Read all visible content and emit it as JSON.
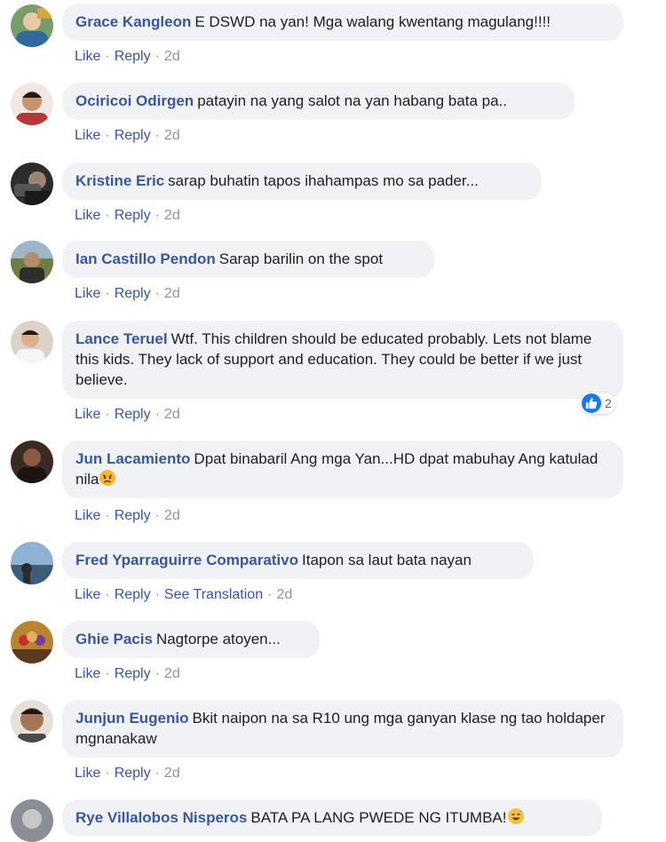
{
  "comments": [
    {
      "author": "Grace Kangleon",
      "text": "E DSWD na yan! Mga walang kwentang magulang!!!!",
      "actions": [
        "Like",
        "Reply"
      ],
      "time": "2d",
      "avatar_color": "#7a9c6a"
    },
    {
      "author": "Ociricoi Odirgen",
      "text": "patayin na yang salot na yan habang bata pa..",
      "actions": [
        "Like",
        "Reply"
      ],
      "time": "2d",
      "avatar_color": "#b36a5c"
    },
    {
      "author": "Kristine Eric",
      "text": "sarap buhatin tapos ihahampas mo sa pader...",
      "actions": [
        "Like",
        "Reply"
      ],
      "time": "2d",
      "avatar_color": "#3b3b3b"
    },
    {
      "author": "Ian Castillo Pendon",
      "text": "Sarap barilin on the spot",
      "actions": [
        "Like",
        "Reply"
      ],
      "time": "2d",
      "avatar_color": "#5d6b3a"
    },
    {
      "author": "Lance Teruel",
      "text": "Wtf. This children should be educated probably. Lets not blame this kids. They lack of support and education. They could be better if we just believe.",
      "actions": [
        "Like",
        "Reply"
      ],
      "time": "2d",
      "avatar_color": "#c9b8a8",
      "reaction_count": "2"
    },
    {
      "author": "Jun Lacamiento",
      "text": "Dpat binabaril Ang mga Yan...HD dpat mabuhay Ang katulad nila",
      "actions": [
        "Like",
        "Reply"
      ],
      "time": "2d",
      "avatar_color": "#5a3a2e",
      "emoji": "angry-face"
    },
    {
      "author": "Fred Yparraguirre Comparativo",
      "text": "Itapon sa laut bata nayan",
      "actions": [
        "Like",
        "Reply",
        "See Translation"
      ],
      "time": "2d",
      "avatar_color": "#4a7fae"
    },
    {
      "author": "Ghie Pacis",
      "text": "Nagtorpe atoyen...",
      "actions": [
        "Like",
        "Reply"
      ],
      "time": "2d",
      "avatar_color": "#c7902e"
    },
    {
      "author": "Junjun Eugenio",
      "text": "Bkit naipon na sa R10 ung mga ganyan klase ng tao holdaper mgnanakaw",
      "actions": [
        "Like",
        "Reply"
      ],
      "time": "2d",
      "avatar_color": "#7a5a48"
    },
    {
      "author": "Rye Villalobos Nisperos",
      "text": "BATA PA LANG PWEDE NG ITUMBA!",
      "actions": [],
      "time": "",
      "avatar_color": "#8a8f96",
      "emoji": "sweat-smile-face"
    }
  ]
}
